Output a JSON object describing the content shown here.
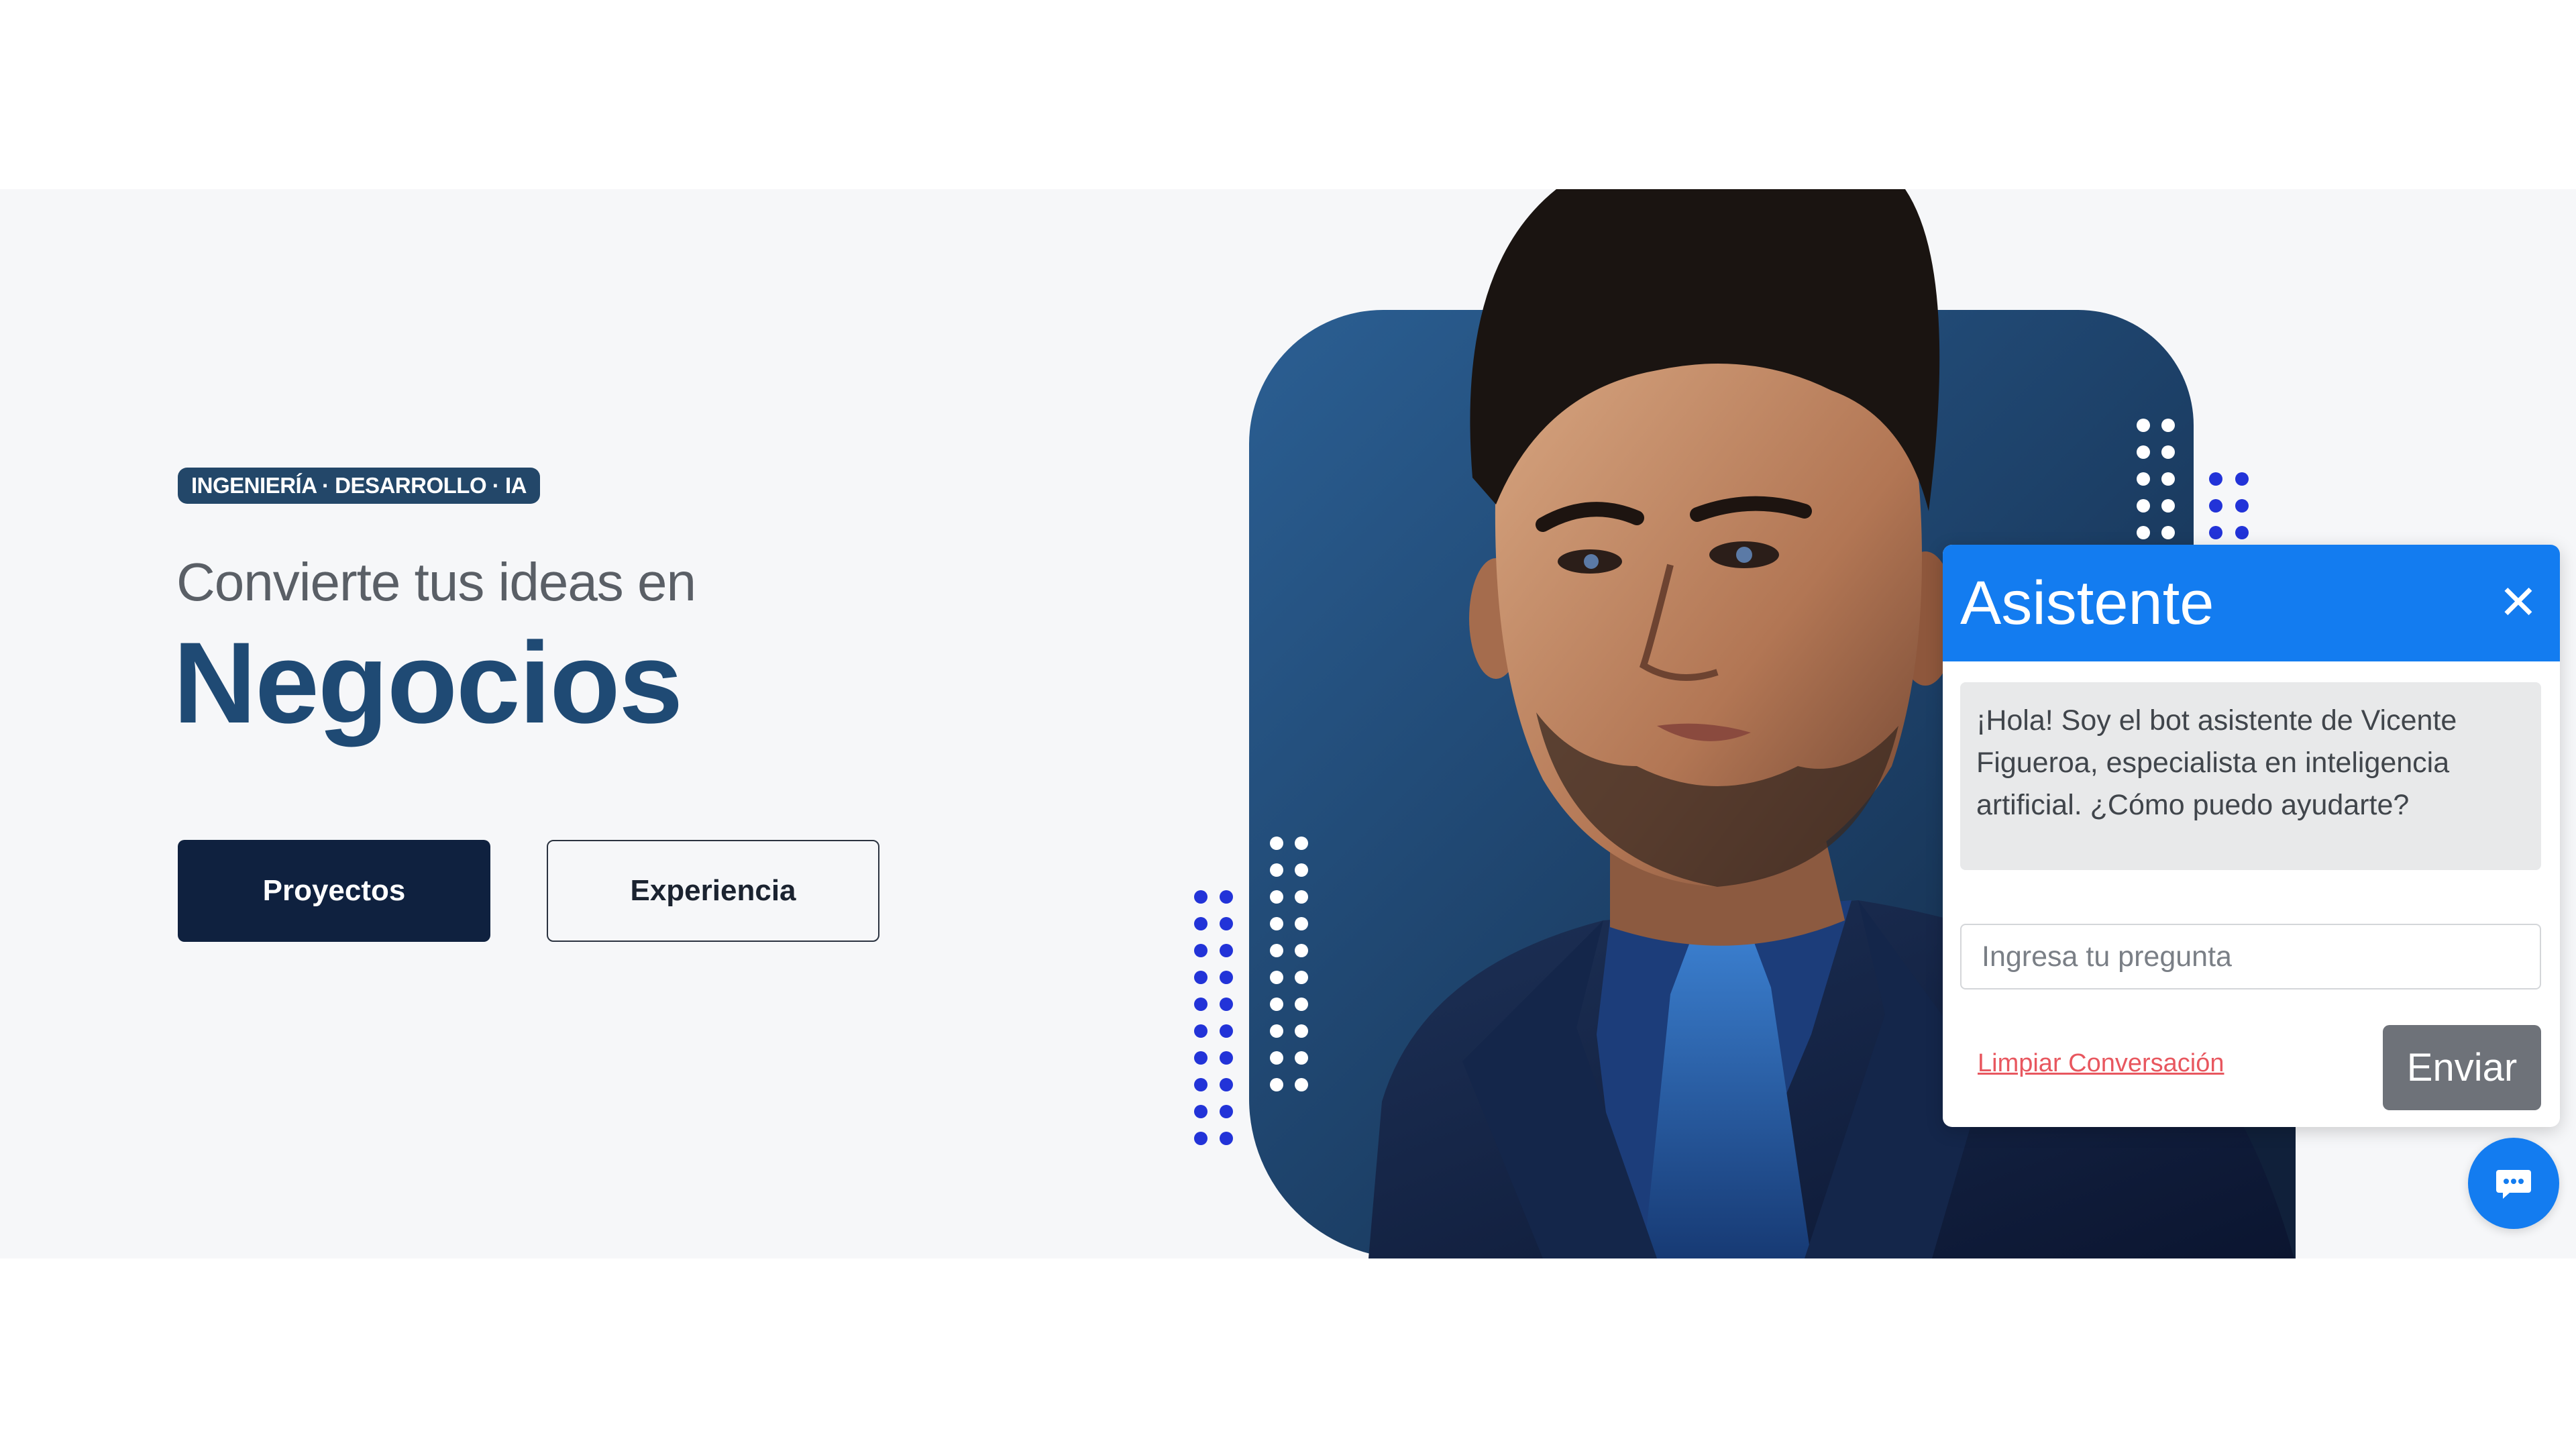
{
  "hero": {
    "tagline": "INGENIERÍA · DESARROLLO · IA",
    "subtitle": "Convierte tus ideas en",
    "title": "Negocios",
    "buttons": {
      "primary": "Proyectos",
      "secondary": "Experiencia"
    }
  },
  "chat": {
    "title": "Asistente",
    "close_icon": "close-icon",
    "bot_message": "¡Hola! Soy el bot asistente de Vicente Figueroa, especialista en inteligencia artificial. ¿Cómo puedo ayudarte?",
    "input_placeholder": "Ingresa tu pregunta",
    "clear_label": "Limpiar Conversación",
    "send_label": "Enviar",
    "fab_icon": "chat-bubble-icon"
  },
  "colors": {
    "primary_dark": "#0f213f",
    "brand_blue": "#1f4a74",
    "chat_blue": "#137cf0",
    "dot_blue": "#2233d8",
    "clear_red": "#e8575f"
  }
}
